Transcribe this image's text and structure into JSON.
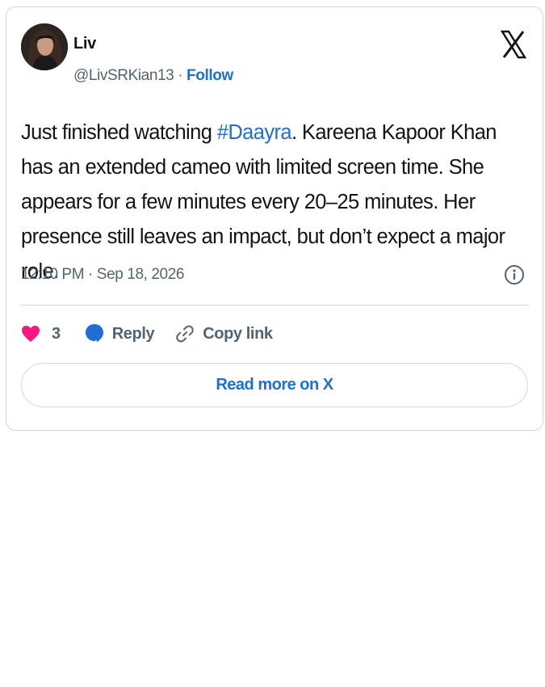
{
  "tweet": {
    "author": {
      "name": "Liv",
      "handle": "@LivSRKian13",
      "separator": " · ",
      "follow_label": "Follow"
    },
    "text": {
      "before_hashtag": "Just finished watching ",
      "hashtag": "#Daayra",
      "after_hashtag": ". Kareena Kapoor Khan has an extended cameo with limited screen time. She appears for a few minutes every 20–25 minutes. Her presence still leaves an impact, but don’t expect a major role."
    },
    "timestamp": "12:10 PM · Sep 18, 2026",
    "actions": {
      "like_count": "3",
      "reply_label": "Reply",
      "copy_link_label": "Copy link"
    },
    "read_more_label": "Read more on X"
  },
  "icons": {
    "platform": "x-logo-icon",
    "info": "info-icon",
    "like": "heart-icon",
    "reply": "speech-bubble-icon",
    "copy": "link-icon"
  },
  "colors": {
    "accent": "#1d6fd6",
    "like": "#f91880",
    "muted_text": "#536471",
    "border": "#cfd9de"
  }
}
